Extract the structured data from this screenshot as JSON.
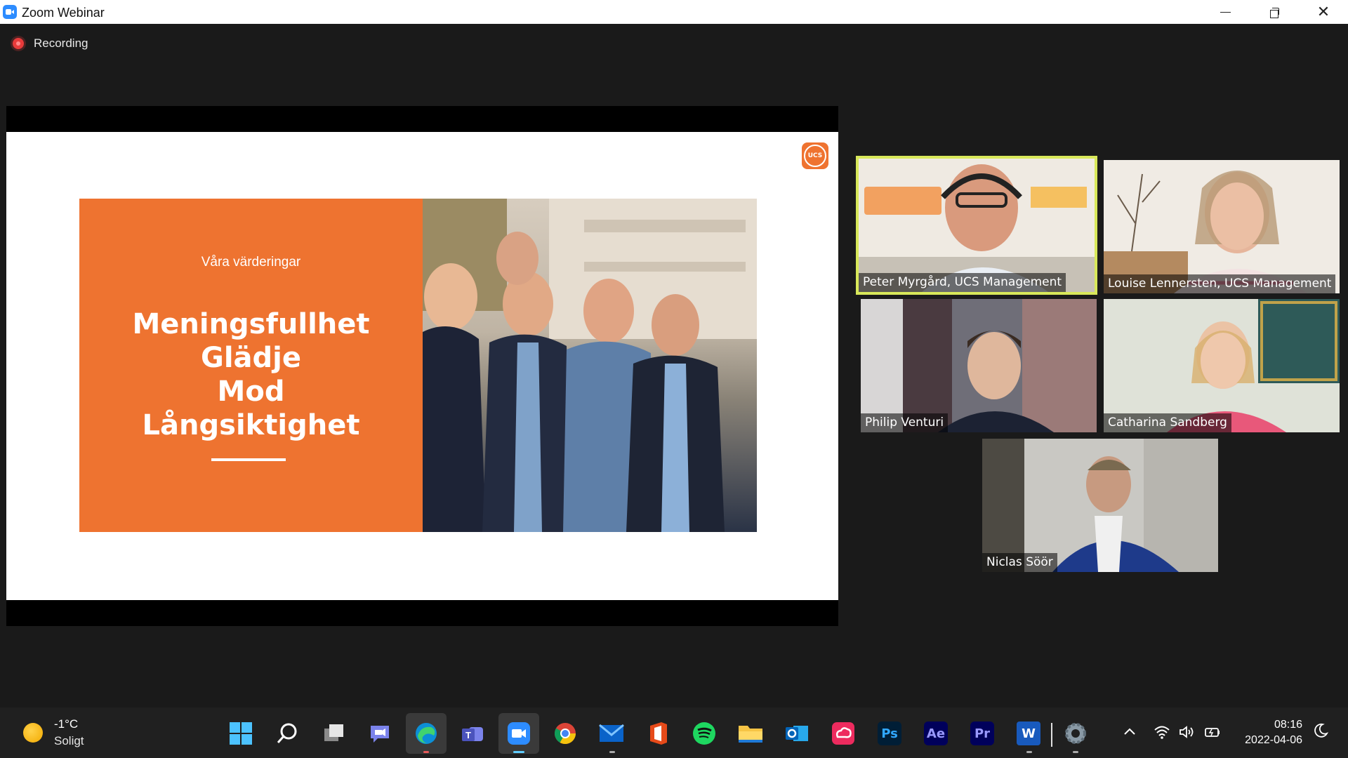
{
  "window": {
    "title": "Zoom Webinar",
    "controls": [
      "minimize",
      "restore",
      "close"
    ]
  },
  "recording": {
    "label": "Recording"
  },
  "shared_slide": {
    "subtitle": "Våra värderingar",
    "values": [
      "Meningsfullhet",
      "Glädje",
      "Mod",
      "Långsiktighet"
    ],
    "logo_text": "UCS",
    "accent_color": "#ee7330"
  },
  "participants": [
    {
      "name": "Peter Myrgård, UCS Management",
      "active_speaker": true
    },
    {
      "name": "Louise Lennersten, UCS Management",
      "active_speaker": false
    },
    {
      "name": "Philip Venturi",
      "active_speaker": false
    },
    {
      "name": "Catharina Sandberg",
      "active_speaker": false
    },
    {
      "name": "Niclas Söör",
      "active_speaker": false
    }
  ],
  "taskbar": {
    "weather": {
      "temp": "-1°C",
      "condition": "Soligt",
      "icon": "sun-icon"
    },
    "apps": [
      "start-icon",
      "search-icon",
      "task-view-icon",
      "chat-icon",
      "edge-icon",
      "teams-icon",
      "zoom-icon",
      "chrome-icon",
      "mail-icon",
      "office-icon",
      "spotify-icon",
      "file-explorer-icon",
      "outlook-icon",
      "creative-cloud-icon",
      "photoshop-icon",
      "after-effects-icon",
      "premiere-icon",
      "word-icon",
      "settings-icon"
    ],
    "app_labels": {
      "photoshop": "Ps",
      "after_effects": "Ae",
      "premiere": "Pr",
      "word": "W"
    },
    "clock": {
      "time": "08:16",
      "date": "2022-04-06"
    }
  }
}
